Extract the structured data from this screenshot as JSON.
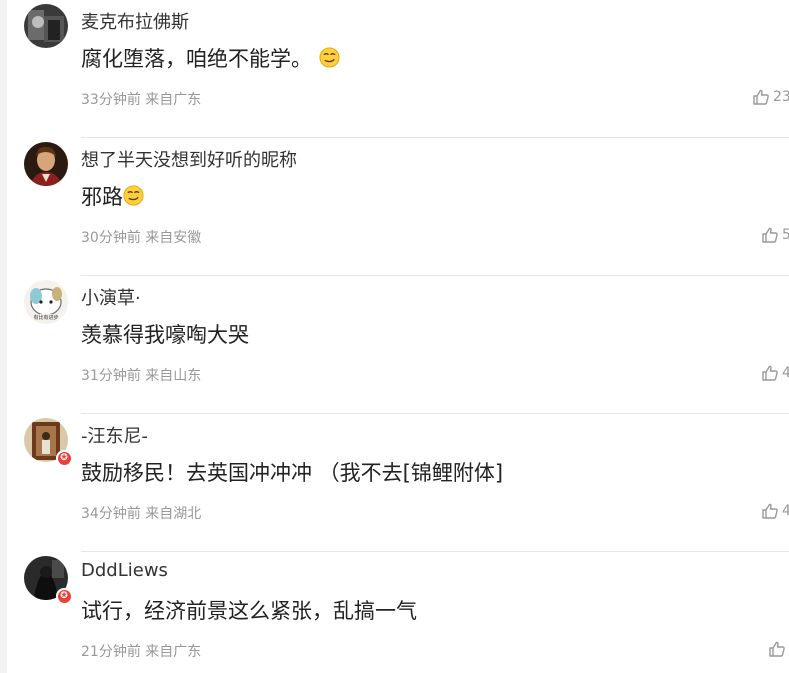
{
  "comments": [
    {
      "username": "麦克布拉佛斯",
      "text": "腐化堕落，咱绝不能学。",
      "emoji": "smirk-emoji",
      "time": "33分钟前",
      "location": "来自广东",
      "likes": "23",
      "vip": false
    },
    {
      "username": "想了半天没想到好听的昵称",
      "text": "邪路",
      "emoji": "smirk-emoji",
      "time": "30分钟前",
      "location": "来自安徽",
      "likes": "5",
      "vip": false
    },
    {
      "username": "小演草·",
      "text": "羡慕得我嚎啕大哭",
      "time": "31分钟前",
      "location": "来自山东",
      "likes": "4",
      "vip": false
    },
    {
      "username": "-汪东尼-",
      "text": "鼓励移民！去英国冲冲冲 （我不去[锦鲤附体]",
      "time": "34分钟前",
      "location": "来自湖北",
      "likes": "4",
      "vip": true
    },
    {
      "username": "DddLiews",
      "text": "试行，经济前景这么紧张，乱搞一气",
      "time": "21分钟前",
      "location": "来自广东",
      "likes": "",
      "vip": true
    }
  ],
  "icons": {
    "like": "thumbs-up-icon",
    "vip": "vip-badge-icon"
  },
  "colors": {
    "username": "#333333",
    "text": "#222222",
    "meta": "#999999",
    "vip_badge": "#e8403a"
  }
}
